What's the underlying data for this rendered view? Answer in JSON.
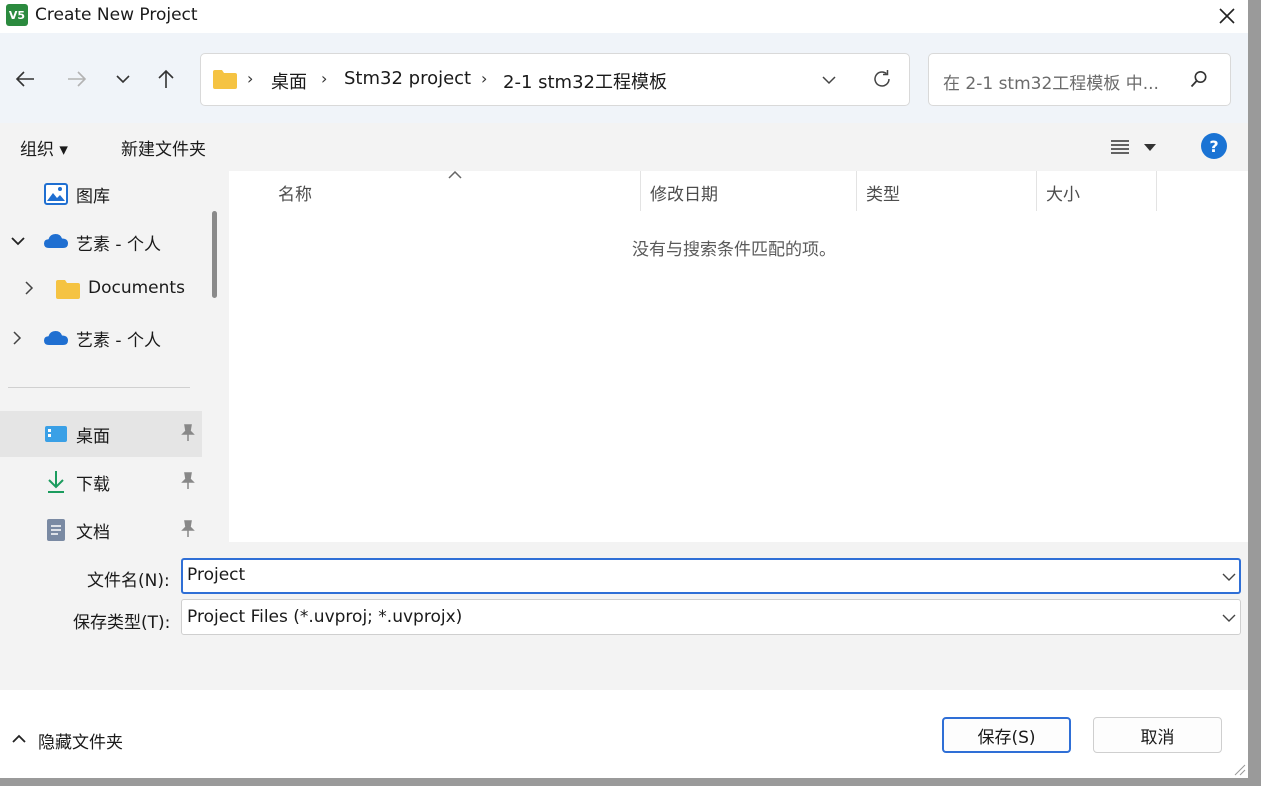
{
  "window": {
    "title": "Create New Project",
    "app_icon_text": "V5"
  },
  "address": {
    "crumbs": [
      "桌面",
      "Stm32 project",
      "2-1 stm32工程模板"
    ],
    "search_placeholder": "在 2-1 stm32工程模板 中..."
  },
  "toolbar": {
    "organize": "组织 ▾",
    "new_folder": "新建文件夹"
  },
  "sidebar": {
    "items": [
      {
        "label": "图库"
      },
      {
        "label": "艺素 - 个人"
      },
      {
        "label": "Documents"
      },
      {
        "label": "艺素 - 个人"
      },
      {
        "label": "桌面"
      },
      {
        "label": "下载"
      },
      {
        "label": "文档"
      }
    ]
  },
  "columns": [
    "名称",
    "修改日期",
    "类型",
    "大小"
  ],
  "empty_message": "没有与搜索条件匹配的项。",
  "filename": {
    "label": "文件名(N):",
    "value": "Project"
  },
  "filetype": {
    "label": "保存类型(T):",
    "value": "Project Files (*.uvproj; *.uvprojx)"
  },
  "footer": {
    "hide_folders": "隐藏文件夹",
    "save": "保存(S)",
    "cancel": "取消"
  },
  "colors": {
    "accent": "#2f6fd6",
    "folder": "#f5c342",
    "onedrive": "#1f6fd1",
    "help": "#1a73d4"
  }
}
